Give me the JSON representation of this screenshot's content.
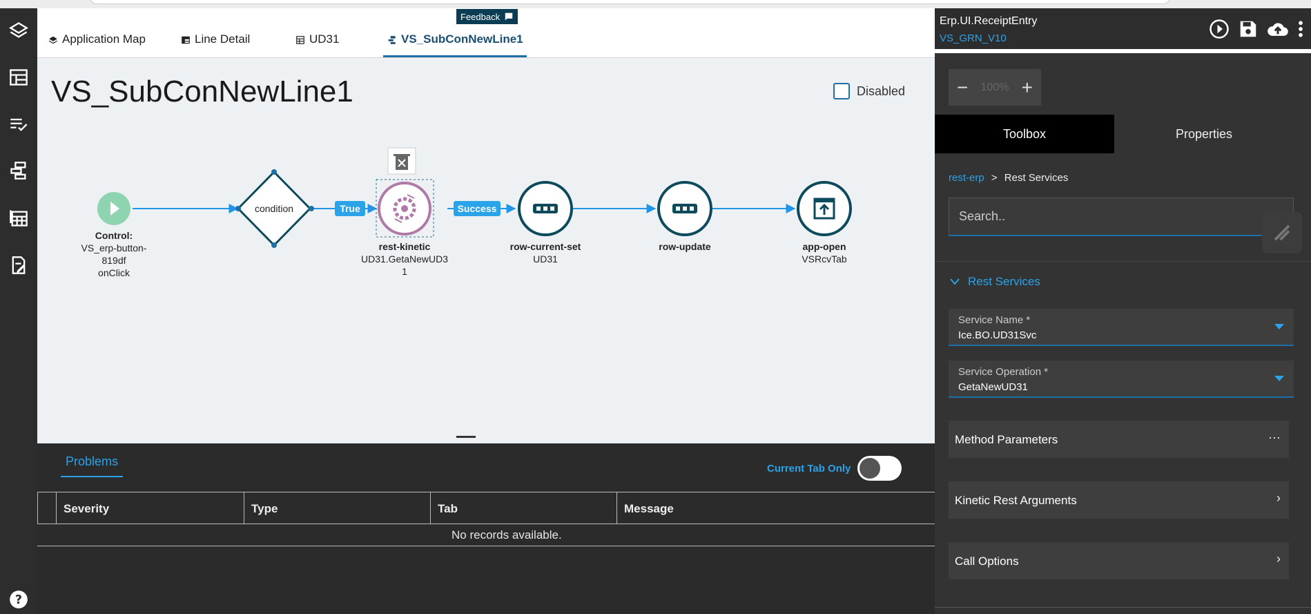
{
  "tabs": [
    {
      "label": "Application Map"
    },
    {
      "label": "Line Detail"
    },
    {
      "label": "UD31"
    },
    {
      "label": "VS_SubConNewLine1"
    }
  ],
  "feedback_label": "Feedback",
  "page": {
    "title": "VS_SubConNewLine1",
    "disabled_label": "Disabled"
  },
  "workflow": {
    "nodes": [
      {
        "id": "trigger",
        "type": "event",
        "title": "Control:",
        "lines": [
          "VS_erp-button-",
          "819df",
          "onClick"
        ]
      },
      {
        "id": "condition",
        "type": "condition",
        "title": "condition"
      },
      {
        "id": "rest",
        "type": "rest-kinetic",
        "title": "rest-kinetic",
        "lines": [
          "UD31.GetaNewUD3",
          "1"
        ]
      },
      {
        "id": "rowset",
        "type": "row-current-set",
        "title": "row-current-set",
        "lines": [
          "UD31"
        ]
      },
      {
        "id": "rowupdate",
        "type": "row-update",
        "title": "row-update",
        "lines": []
      },
      {
        "id": "appopen",
        "type": "app-open",
        "title": "app-open",
        "lines": [
          "VSRcvTab"
        ]
      }
    ],
    "edge_labels": {
      "true": "True",
      "success": "Success"
    },
    "colors": {
      "line": "#2196e8",
      "node_stroke": "#0d4a5c",
      "event": "#8fd4b0",
      "selected": "#b07aa8",
      "badge": "#2aa3e8"
    }
  },
  "problems": {
    "tab_label": "Problems",
    "current_tab_only_label": "Current Tab Only",
    "columns": [
      "Severity",
      "Type",
      "Tab",
      "Message"
    ],
    "empty_text": "No records available."
  },
  "right_panel": {
    "app_name": "Erp.UI.ReceiptEntry",
    "version": "VS_GRN_V10",
    "zoom": {
      "minus": "−",
      "value": "100%",
      "plus": "+"
    },
    "segments": [
      "Toolbox",
      "Properties"
    ],
    "breadcrumb": {
      "root": "rest-erp",
      "sep": ">",
      "current": "Rest Services"
    },
    "search_placeholder": "Search..",
    "section_title": "Rest Services",
    "service_name": {
      "label": "Service Name *",
      "value": "Ice.BO.UD31Svc"
    },
    "service_operation": {
      "label": "Service Operation *",
      "value": "GetaNewUD31"
    },
    "accordions": [
      {
        "label": "Method Parameters",
        "end": "···"
      },
      {
        "label": "Kinetic Rest Arguments",
        "end": "›"
      },
      {
        "label": "Call Options",
        "end": "›"
      }
    ]
  }
}
